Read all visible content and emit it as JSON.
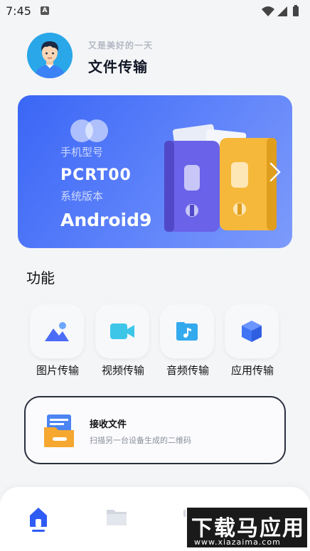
{
  "status_bar": {
    "time": "7:45",
    "notif_badge": "A"
  },
  "header": {
    "greeting": "又是美好的一天",
    "title": "文件传输"
  },
  "banner": {
    "device_label": "手机型号",
    "device_model": "PCRT00",
    "system_label": "系统版本",
    "system_version": "Android9",
    "gradient_start": "#3a66f6",
    "gradient_end": "#7d9bfb"
  },
  "section": {
    "title": "功能"
  },
  "features": [
    {
      "label": "图片传输",
      "icon": "image-icon",
      "color": "#4a6cf7"
    },
    {
      "label": "视频传输",
      "icon": "video-icon",
      "color": "#3dc6e8"
    },
    {
      "label": "音频传输",
      "icon": "music-folder-icon",
      "color": "#33a9ee"
    },
    {
      "label": "应用传输",
      "icon": "cube-icon",
      "color": "#3f74f4"
    }
  ],
  "receive": {
    "title": "接收文件",
    "subtitle": "扫描另一台设备生成的二维码"
  },
  "bottom_nav": [
    {
      "icon": "home-icon",
      "active": true
    },
    {
      "icon": "folder-icon",
      "active": false
    },
    {
      "icon": "grid-icon",
      "active": false
    },
    {
      "icon": "profile-icon",
      "active": false
    }
  ],
  "watermark": {
    "main": "下载马应用",
    "url": "www.xiazaima.com"
  },
  "colors": {
    "accent": "#2f5bf5",
    "background": "#f4f5f7"
  }
}
